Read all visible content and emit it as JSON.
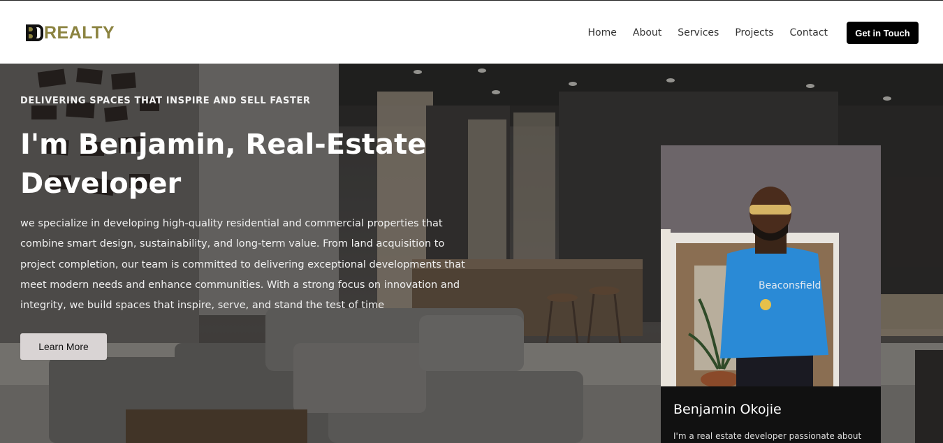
{
  "header": {
    "logo_text": "REALTY",
    "nav": [
      "Home",
      "About",
      "Services",
      "Projects",
      "Contact"
    ],
    "cta_label": "Get in Touch"
  },
  "hero": {
    "tagline": "DELIVERING SPACES THAT INSPIRE AND SELL FASTER",
    "headline": "I'm Benjamin, Real-Estate Developer",
    "intro": "we specialize in developing high-quality residential and commercial properties that combine smart design, sustainability, and long-term value. From land acquisition to project completion, our team is committed to delivering exceptional developments that meet modern needs and enhance communities. With a strong focus on innovation and integrity, we build spaces that inspire, serve, and stand the test of time",
    "learn_more_label": "Learn More"
  },
  "profile": {
    "name": "Benjamin Okojie",
    "bio": "I'm a real estate developer passionate about"
  },
  "colors": {
    "brand_gold": "#8b8340",
    "cta_bg": "#000000",
    "learn_more_bg": "#d9d4d4",
    "card_bg": "#111111"
  }
}
